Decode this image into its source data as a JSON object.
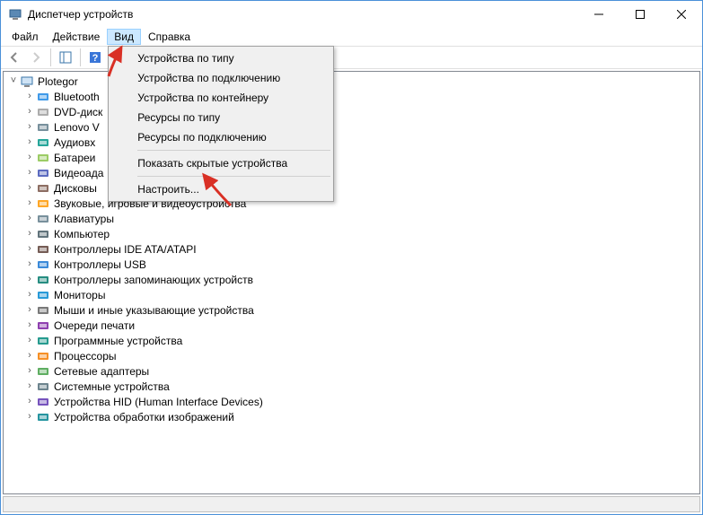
{
  "window": {
    "title": "Диспетчер устройств"
  },
  "menubar": {
    "items": [
      "Файл",
      "Действие",
      "Вид",
      "Справка"
    ],
    "open_index": 2
  },
  "view_menu": {
    "items": [
      "Устройства по типу",
      "Устройства по подключению",
      "Устройства по контейнеру",
      "Ресурсы по типу",
      "Ресурсы по подключению",
      "Показать скрытые устройства",
      "Настроить..."
    ]
  },
  "tree": {
    "root": "Plotegor",
    "nodes": [
      "Bluetooth",
      "DVD-диск",
      "Lenovo V",
      "Аудиовх",
      "Батареи",
      "Видеоада",
      "Дисковы",
      "Звуковые, игровые и видеоустройства",
      "Клавиатуры",
      "Компьютер",
      "Контроллеры IDE ATA/ATAPI",
      "Контроллеры USB",
      "Контроллеры запоминающих устройств",
      "Мониторы",
      "Мыши и иные указывающие устройства",
      "Очереди печати",
      "Программные устройства",
      "Процессоры",
      "Сетевые адаптеры",
      "Системные устройства",
      "Устройства HID (Human Interface Devices)",
      "Устройства обработки изображений"
    ]
  },
  "icons": {
    "tree_nodes": [
      "bluetooth-icon",
      "disc-icon",
      "generic-device-icon",
      "audio-input-icon",
      "battery-icon",
      "display-adapter-icon",
      "disk-drive-icon",
      "sound-icon",
      "keyboard-icon",
      "computer-icon",
      "ide-controller-icon",
      "usb-controller-icon",
      "storage-controller-icon",
      "monitor-icon",
      "mouse-icon",
      "printer-queue-icon",
      "software-device-icon",
      "processor-icon",
      "network-adapter-icon",
      "system-device-icon",
      "hid-device-icon",
      "imaging-device-icon"
    ]
  },
  "colors": {
    "accent_border": "#4a90d9",
    "menu_highlight": "#cce8ff",
    "annotation_red": "#d93025"
  }
}
